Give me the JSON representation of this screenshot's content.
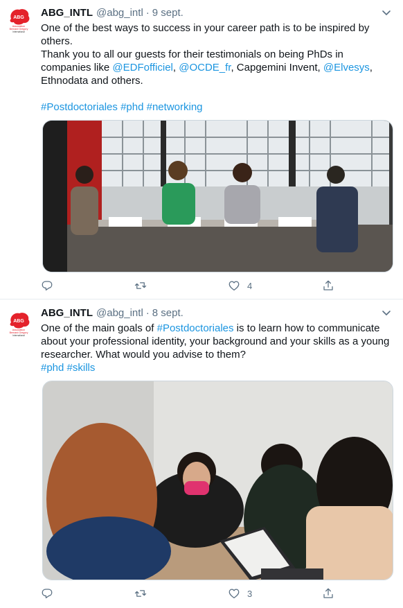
{
  "tweets": [
    {
      "name": "ABG_INTL",
      "handle": "@abg_intl",
      "separator": "·",
      "date": "9 sept.",
      "lines": [
        [
          {
            "t": "One of the best ways to success in your career path is to be inspired by"
          }
        ],
        [
          {
            "t": "others."
          }
        ],
        [
          {
            "t": "Thank you to all our guests for their testimonials on being PhDs in"
          }
        ],
        [
          {
            "t": "companies like "
          },
          {
            "t": "@EDFofficiel",
            "link": true
          },
          {
            "t": ", "
          },
          {
            "t": "@OCDE_fr",
            "link": true
          },
          {
            "t": ", Capgemini Invent, "
          },
          {
            "t": "@Elvesys",
            "link": true
          },
          {
            "t": ","
          }
        ],
        [
          {
            "t": "Ethnodata and others."
          }
        ],
        [
          {
            "t": ""
          }
        ],
        [
          {
            "t": "#Postdoctoriales",
            "link": true
          },
          {
            "t": " "
          },
          {
            "t": "#phd",
            "link": true
          },
          {
            "t": " "
          },
          {
            "t": "#networking",
            "link": true
          }
        ]
      ],
      "replies": "",
      "retweets": "",
      "likes": "4"
    },
    {
      "name": "ABG_INTL",
      "handle": "@abg_intl",
      "separator": "·",
      "date": "8 sept.",
      "lines": [
        [
          {
            "t": "One of the main goals of "
          },
          {
            "t": "#Postdoctoriales",
            "link": true
          },
          {
            "t": " is to learn how to communicate"
          }
        ],
        [
          {
            "t": "about your professional identity, your background and your skills as a young"
          }
        ],
        [
          {
            "t": "researcher. What would you advise to them?"
          }
        ],
        [
          {
            "t": "#phd",
            "link": true
          },
          {
            "t": " "
          },
          {
            "t": "#skills",
            "link": true
          }
        ]
      ],
      "replies": "",
      "retweets": "",
      "likes": "3"
    }
  ],
  "avatar": {
    "logo_text": "ABG",
    "caption_lines": [
      "Association",
      "Bernard Gregory",
      "International"
    ]
  },
  "colors": {
    "link": "#1b95e0",
    "secondary": "#5b7083",
    "logo_red": "#e4222b",
    "divider": "#e6ecf0"
  },
  "icons": [
    "chevron-down-icon",
    "reply-icon",
    "retweet-icon",
    "like-icon",
    "share-icon"
  ]
}
